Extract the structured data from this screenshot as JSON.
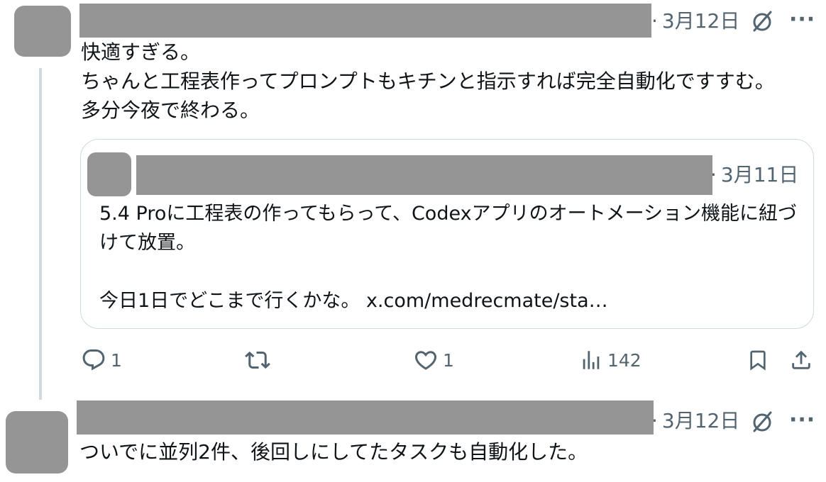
{
  "post1": {
    "date": "3月12日",
    "text": "快適すぎる。\nちゃんと工程表作ってプロンプトもキチンと指示すれば完全自動化ですすむ。多分今夜で終わる。",
    "quote": {
      "date": "3月11日",
      "text": "5.4 Proに工程表の作ってもらって、Codexアプリのオートメーション機能に紐づけて放置。\n\n今日1日でどこまで行くかな。 x.com/medrecmate/sta…"
    },
    "actions": {
      "reply_count": "1",
      "repost_count": "",
      "like_count": "1",
      "views_count": "142"
    }
  },
  "post2": {
    "date": "3月12日",
    "text": "ついでに並列2件、後回しにしてたタスクも自動化した。"
  },
  "icons": {
    "grok": "slash-circle-icon",
    "more": "more-dots-icon",
    "reply": "reply-icon",
    "repost": "repost-icon",
    "like": "heart-icon",
    "views": "analytics-icon",
    "bookmark": "bookmark-icon",
    "share": "share-icon"
  },
  "colors": {
    "muted": "#536471",
    "redaction": "#959595",
    "border": "#cfd9de"
  }
}
